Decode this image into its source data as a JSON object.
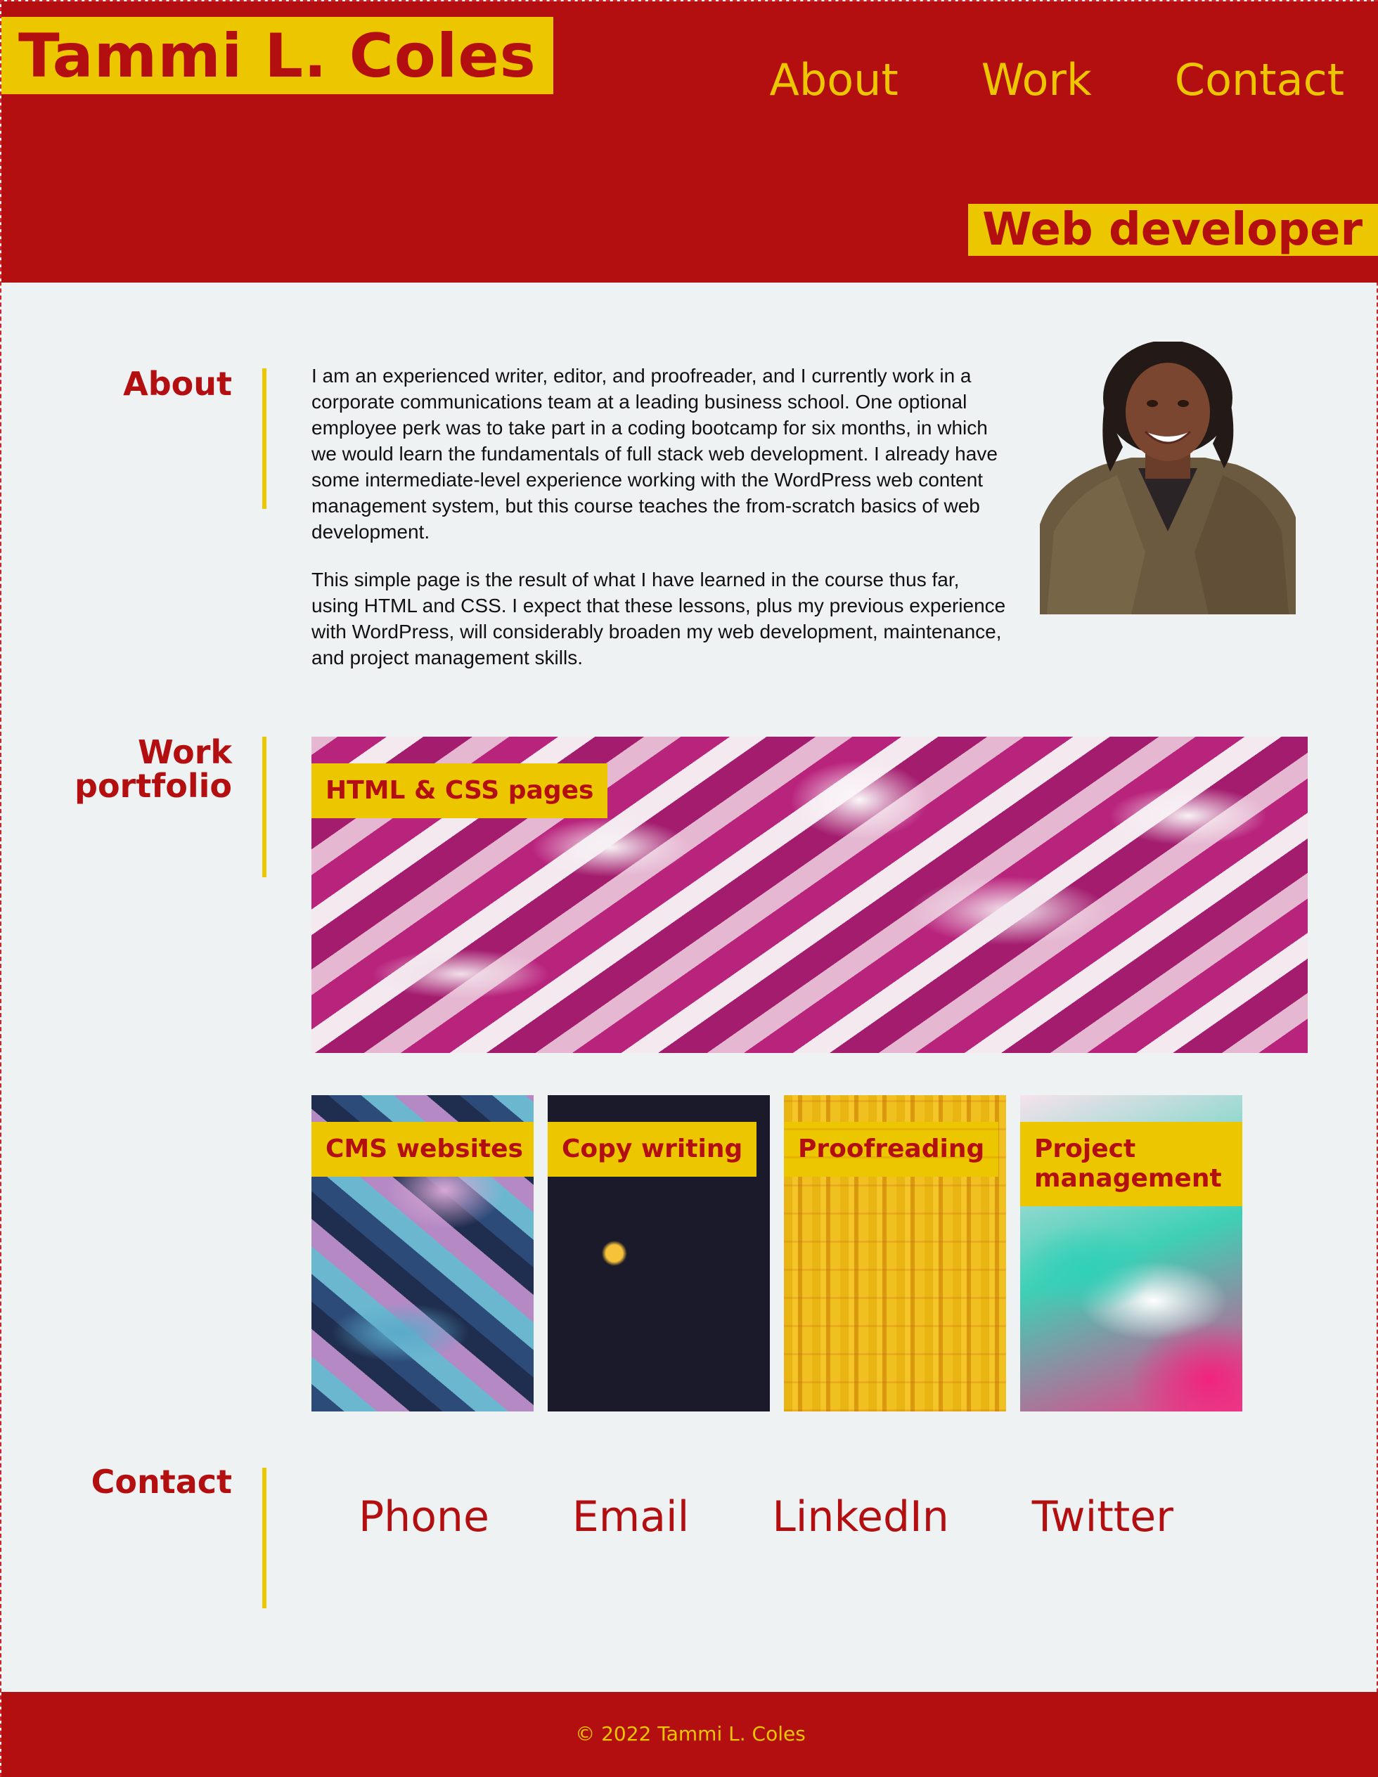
{
  "header": {
    "title": "Tammi L. Coles",
    "subtitle": "Web developer",
    "nav": [
      "About",
      "Work",
      "Contact"
    ]
  },
  "about": {
    "heading": "About",
    "paragraphs": [
      "I am an experienced writer, editor, and proofreader, and I currently work in a corporate communications team at a leading business school. One optional employee perk was to take part in a coding bootcamp for six months, in which we would learn the fundamentals of full stack web development. I already have some intermediate-level experience working with the WordPress web content management system, but this course teaches the from-scratch basics of web development.",
      "This simple page is the result of what I have learned in the course thus far, using HTML and CSS. I expect that these lessons, plus my previous experience with WordPress, will considerably broaden my web development, maintenance, and project management skills."
    ]
  },
  "work": {
    "heading_line1": "Work",
    "heading_line2": "portfolio",
    "tiles": [
      {
        "label": "HTML & CSS pages"
      },
      {
        "label": "CMS websites"
      },
      {
        "label": "Copy writing"
      },
      {
        "label": "Proofreading"
      },
      {
        "label": "Project management"
      }
    ]
  },
  "contact": {
    "heading": "Contact",
    "links": [
      "Phone",
      "Email",
      "LinkedIn",
      "Twitter"
    ]
  },
  "footer": {
    "text": "© 2022 Tammi L. Coles"
  },
  "colors": {
    "primary_red": "#b30e10",
    "accent_gold": "#ecc700",
    "background": "#eef2f3"
  }
}
